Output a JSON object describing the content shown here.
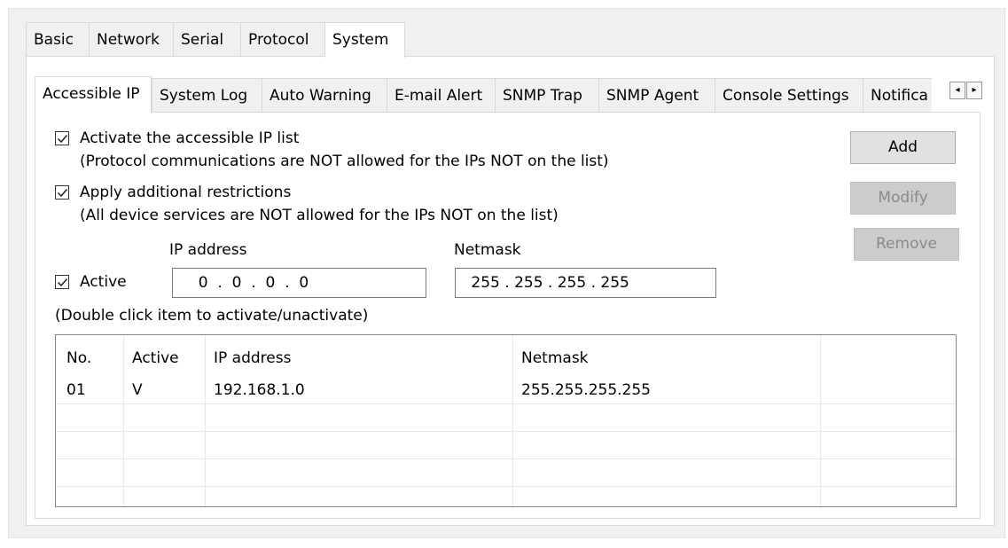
{
  "top_tabs": [
    "Basic",
    "Network",
    "Serial",
    "Protocol",
    "System"
  ],
  "sub_tabs": [
    "Accessible IP",
    "System Log",
    "Auto Warning",
    "E-mail Alert",
    "SNMP Trap",
    "SNMP Agent",
    "Console Settings",
    "Notifica"
  ],
  "scroll": {
    "left": "◂",
    "right": "▸"
  },
  "options": {
    "activate_label": "Activate the accessible IP list",
    "activate_note": "(Protocol communications are NOT allowed for the IPs NOT on the list)",
    "restrict_label": "Apply additional restrictions",
    "restrict_note": "(All device services are NOT allowed for the IPs NOT on the list)"
  },
  "buttons": {
    "add": "Add",
    "modify": "Modify",
    "remove": "Remove"
  },
  "form": {
    "ip_label": "IP address",
    "netmask_label": "Netmask",
    "active_label": "Active",
    "ip_value": "  0  .  0  .  0  .  0",
    "netmask_value": " 255 . 255 . 255 . 255",
    "hint": "(Double click item to activate/unactivate)"
  },
  "table": {
    "headers": [
      "No.",
      "Active",
      "IP address",
      "Netmask"
    ],
    "rows": [
      [
        "01",
        "V",
        "192.168.1.0",
        "255.255.255.255"
      ]
    ]
  }
}
